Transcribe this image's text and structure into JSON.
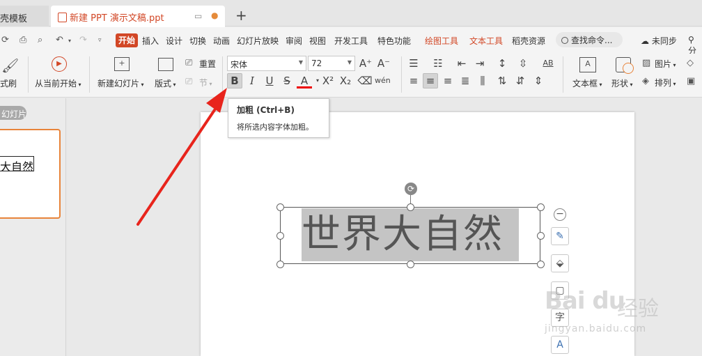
{
  "tabs": {
    "template_tab": "壳模板",
    "document_tab": "新建 PPT 演示文稿.ppt",
    "add": "+"
  },
  "menu": {
    "active": "开始",
    "items": [
      "插入",
      "设计",
      "切换",
      "动画",
      "幻灯片放映",
      "审阅",
      "视图",
      "开发工具",
      "特色功能"
    ],
    "context_items": [
      "绘图工具",
      "文本工具"
    ],
    "resource": "稻壳资源",
    "search_placeholder": "查找命令...",
    "sync": "未同步",
    "share": "分"
  },
  "ribbon": {
    "format_painter": "式刷",
    "play_from_current": "从当前开始",
    "new_slide": "新建幻灯片",
    "layout": "版式",
    "reset": "重置",
    "section": "节",
    "font_name": "宋体",
    "font_size": "72",
    "text_box": "文本框",
    "shape": "形状",
    "picture": "图片",
    "arrange": "排列"
  },
  "tooltip": {
    "title": "加粗 (Ctrl+B)",
    "description": "将所选内容字体加粗。"
  },
  "left_panel": {
    "tag": "幻灯片",
    "thumb_text": "大自然"
  },
  "slide": {
    "title": "世界大自然"
  },
  "watermark": {
    "logo": "Bai du",
    "cn": "经验",
    "url": "jingyan.baidu.com"
  },
  "colors": {
    "accent": "#d24726",
    "selection": "#c4c4c4",
    "thumb_border": "#e8843a",
    "arrow": "#e8241c"
  }
}
